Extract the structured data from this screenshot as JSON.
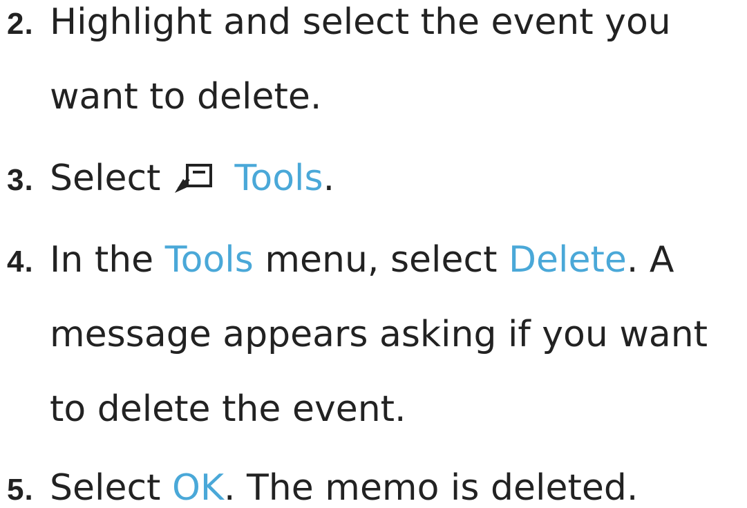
{
  "colors": {
    "text": "#222222",
    "highlight": "#4aa8d8"
  },
  "steps": [
    {
      "number": "2.",
      "lines": [
        "Highlight and select the event you",
        "want to delete."
      ]
    },
    {
      "number": "3.",
      "select_text": "Select",
      "icon": "tools-remote-icon",
      "tools_label": "Tools",
      "period": "."
    },
    {
      "number": "4.",
      "line1_pre": "In the",
      "line1_tools": "Tools",
      "line1_mid": "menu, select",
      "line1_delete": "Delete",
      "line1_post": ". A",
      "line2": "message appears asking if you want",
      "line3": "to delete the event."
    },
    {
      "number": "5.",
      "pre": "Select",
      "ok": "OK",
      "post": ". The memo is deleted."
    }
  ]
}
